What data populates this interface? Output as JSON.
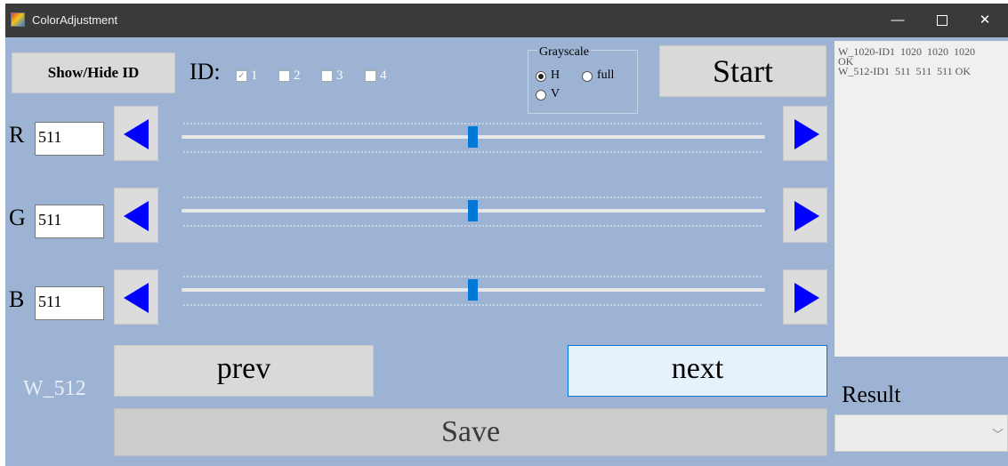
{
  "window": {
    "title": "ColorAdjustment"
  },
  "titlebar": {
    "min_glyph": "—",
    "close_glyph": "✕"
  },
  "controls": {
    "show_hide_label": "Show/Hide ID",
    "id_label": "ID:",
    "id_options": [
      {
        "label": "1",
        "checked": true
      },
      {
        "label": "2",
        "checked": false
      },
      {
        "label": "3",
        "checked": false
      },
      {
        "label": "4",
        "checked": false
      }
    ],
    "start_label": "Start"
  },
  "grayscale": {
    "title": "Grayscale",
    "options": [
      {
        "label": "H",
        "selected": true
      },
      {
        "label": "full",
        "selected": false
      },
      {
        "label": "V",
        "selected": false
      }
    ]
  },
  "channels": [
    {
      "label": "R",
      "value": "511",
      "slider_fraction": 0.5
    },
    {
      "label": "G",
      "value": "511",
      "slider_fraction": 0.5
    },
    {
      "label": "B",
      "value": "511",
      "slider_fraction": 0.5
    }
  ],
  "log": {
    "lines": [
      "W_1020-ID1  1020  1020  1020",
      "OK",
      "W_512-ID1  511  511  511 OK"
    ]
  },
  "navigation": {
    "page_label": "W_512",
    "prev_label": "prev",
    "next_label": "next",
    "save_label": "Save"
  },
  "result": {
    "label": "Result",
    "value": "",
    "chevron": "﹀"
  },
  "colors": {
    "window_bg": "#9db3d3",
    "arrow": "#0000ff",
    "thumb": "#0078d7",
    "titlebar": "#3a3a3a"
  }
}
